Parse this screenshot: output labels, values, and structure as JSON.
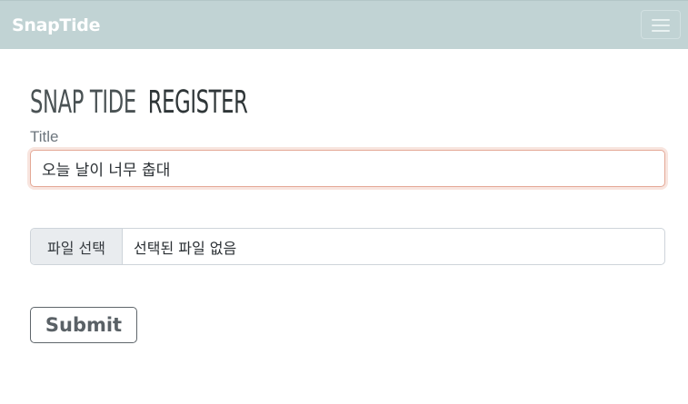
{
  "navbar": {
    "brand": "SnapTide",
    "toggler_icon": "hamburger-menu-icon"
  },
  "page": {
    "title_part1": "SNAP TIDE",
    "title_part2": "REGISTER"
  },
  "form": {
    "title_label": "Title",
    "title_value": "오늘 날이 너무 춥대",
    "file_button_label": "파일 선택",
    "file_status": "선택된 파일 없음",
    "submit_label": "Submit"
  },
  "colors": {
    "navbar_bg": "#c1d3d4",
    "focus_border": "#e4a896"
  }
}
